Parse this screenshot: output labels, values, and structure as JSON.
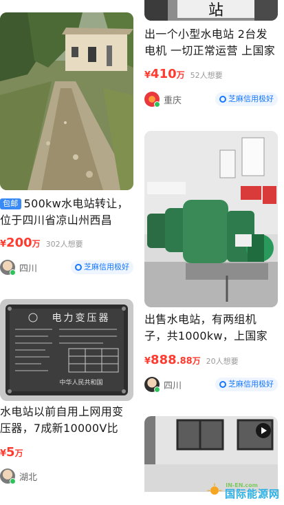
{
  "listings_left": [
    {
      "image": "dirt-road-building-photo",
      "tag": "包邮",
      "title": "500kw水电站转让，位于四川省凉山州西昌",
      "price_symbol": "¥",
      "price_int": "200",
      "price_unit": "万",
      "wants": "302人想要",
      "city": "四川",
      "credit": "芝麻信用极好"
    },
    {
      "image": "transformer-nameplate-photo",
      "title": "水电站以前自用上网用变压器，7成新10000V比",
      "price_symbol": "¥",
      "price_int": "5",
      "price_unit": "万",
      "city": "湖北"
    }
  ],
  "listings_right": [
    {
      "image": "hydro-station-sign-photo",
      "title": "出一个小型水电站  2台发电机 一切正常运营 上国家",
      "price_symbol": "¥",
      "price_int": "410",
      "price_unit": "万",
      "wants": "52人想要",
      "city": "重庆",
      "credit": "芝麻信用极好"
    },
    {
      "image": "generator-room-photo",
      "title": "出售水电站，有两组机子，共1000kw，上国家电",
      "price_symbol": "¥",
      "price_int": "888",
      "price_dec": ".88",
      "price_unit": "万",
      "wants": "20人想要",
      "city": "四川",
      "credit": "芝麻信用极好"
    },
    {
      "image": "video-building-photo"
    }
  ],
  "nameplate": {
    "heading": "电力变压器",
    "footer": "中华人民共和国"
  },
  "sign_char": "站",
  "watermark": {
    "en": "IN-EN.com",
    "cn": "国际能源网"
  },
  "colors": {
    "price": "#ff3b30",
    "tag": "#3a8af5",
    "credit": "#1677ff"
  }
}
